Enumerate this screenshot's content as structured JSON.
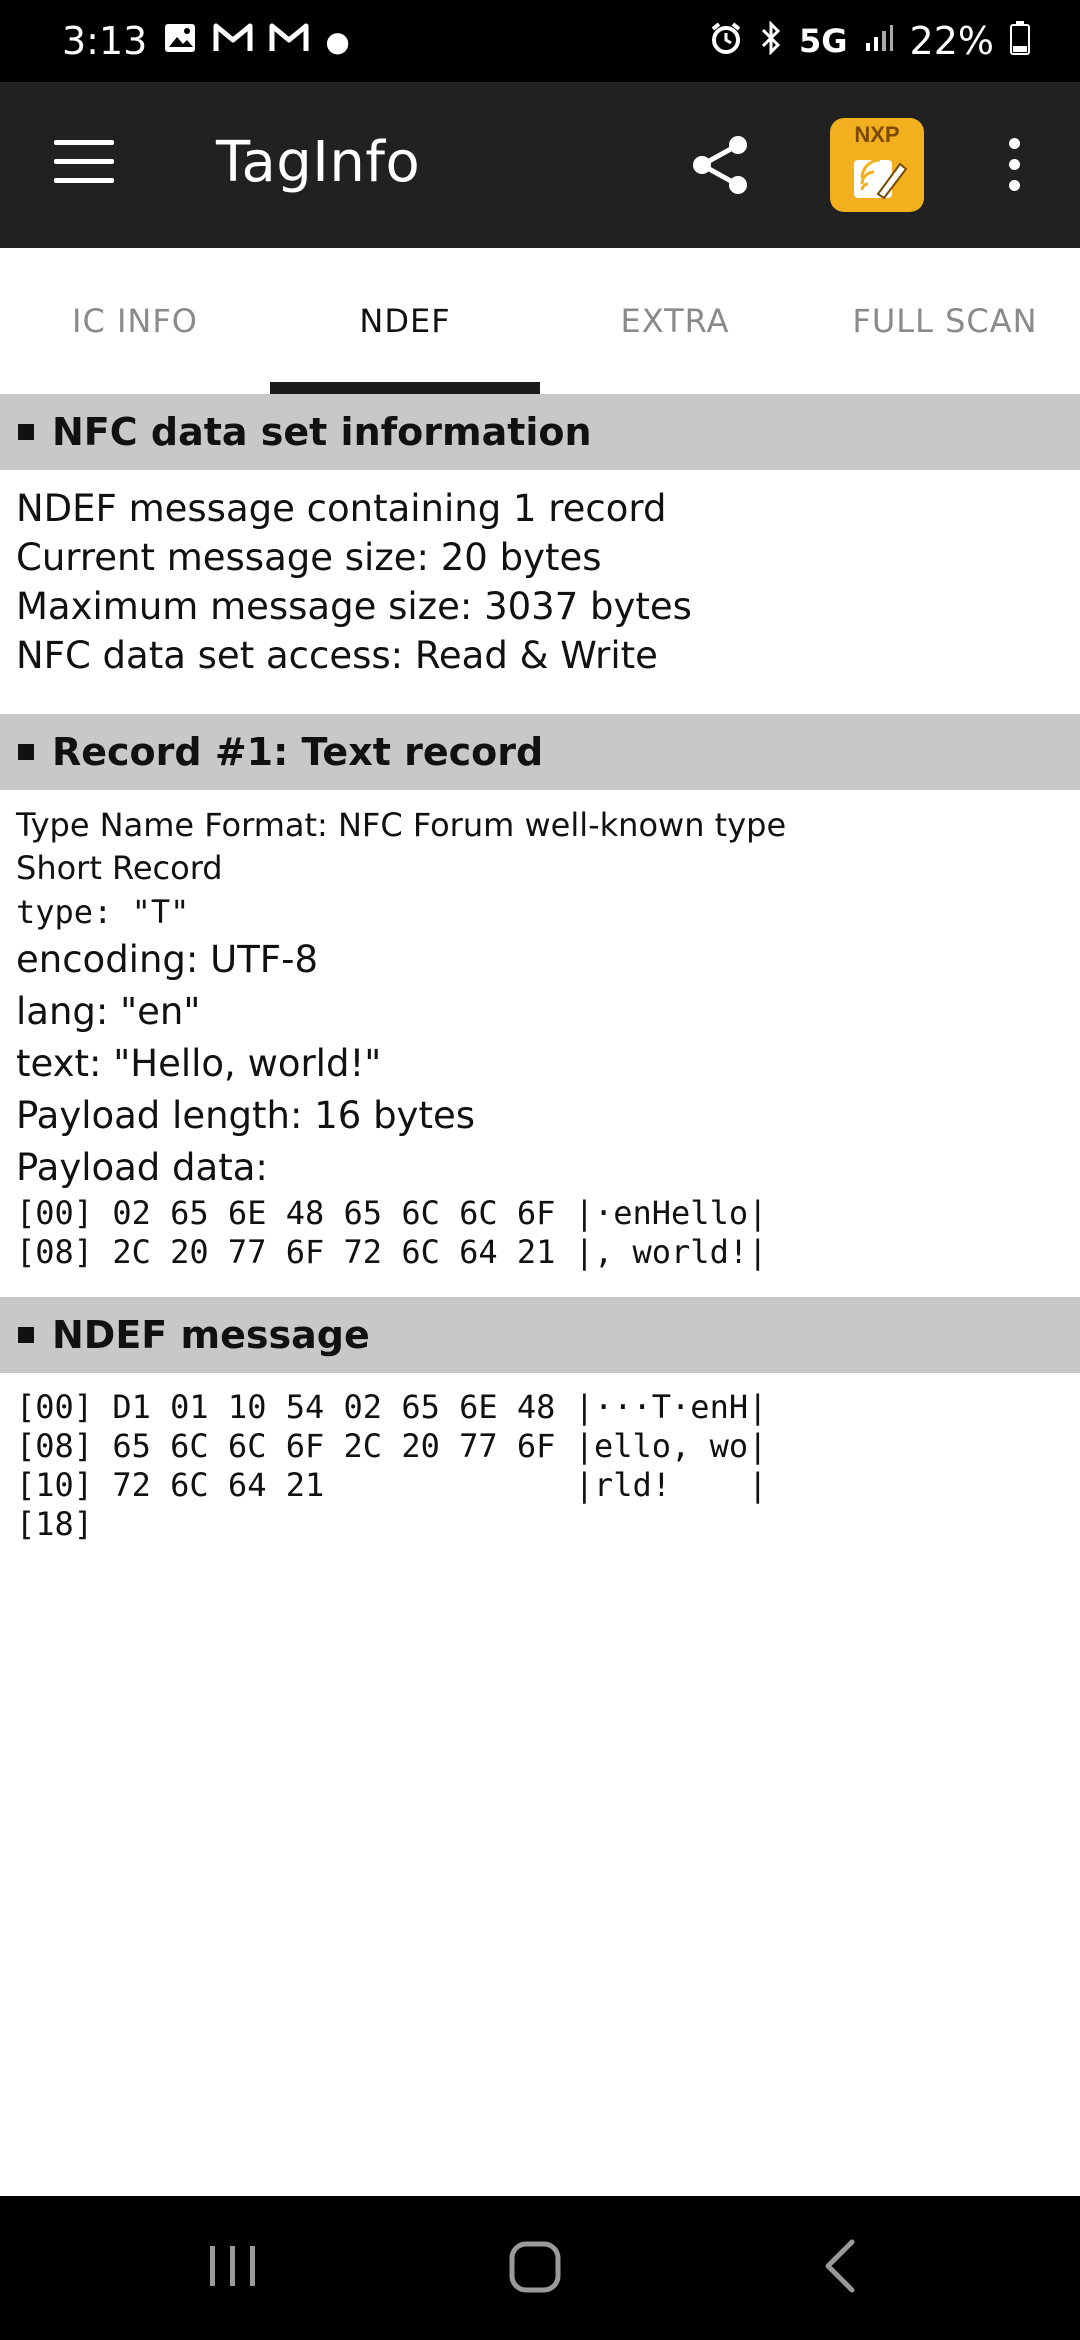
{
  "status_bar": {
    "time": "3:13",
    "left_icons": [
      "image-icon",
      "gmail-icon",
      "gmail-icon",
      "dot-icon"
    ],
    "network": "5G",
    "battery": "22%"
  },
  "app_bar": {
    "title": "TagInfo",
    "logo_text": "NXP"
  },
  "tabs": [
    {
      "label": "IC INFO",
      "active": false
    },
    {
      "label": "NDEF",
      "active": true
    },
    {
      "label": "EXTRA",
      "active": false
    },
    {
      "label": "FULL SCAN",
      "active": false
    }
  ],
  "sections": {
    "dataset": {
      "title": "NFC data set information",
      "lines": [
        "NDEF message containing 1 record",
        "Current message size: 20 bytes",
        "Maximum message size: 3037 bytes",
        "NFC data set access: Read & Write"
      ]
    },
    "record": {
      "title": "Record #1: Text record",
      "tnf": "Type Name Format: NFC Forum well-known type",
      "short_record": "Short Record",
      "type_line": "type: \"T\"",
      "encoding": "encoding: UTF-8",
      "lang": "lang: \"en\"",
      "text": "text: \"Hello, world!\"",
      "payload_length": "Payload length: 16 bytes",
      "payload_label": "Payload data:",
      "payload_hex": [
        "[00] 02 65 6E 48 65 6C 6C 6F |·enHello|",
        "[08] 2C 20 77 6F 72 6C 64 21 |, world!|"
      ]
    },
    "message": {
      "title": "NDEF message",
      "hex": [
        "[00] D1 01 10 54 02 65 6E 48 |···T·enH|",
        "[08] 65 6C 6C 6F 2C 20 77 6F |ello, wo|",
        "[10] 72 6C 64 21             |rld!    |",
        "[18]"
      ]
    }
  },
  "colors": {
    "app_bar": "#212121",
    "section_header": "#c8c8c8",
    "nxp_badge": "#f2b01e"
  }
}
